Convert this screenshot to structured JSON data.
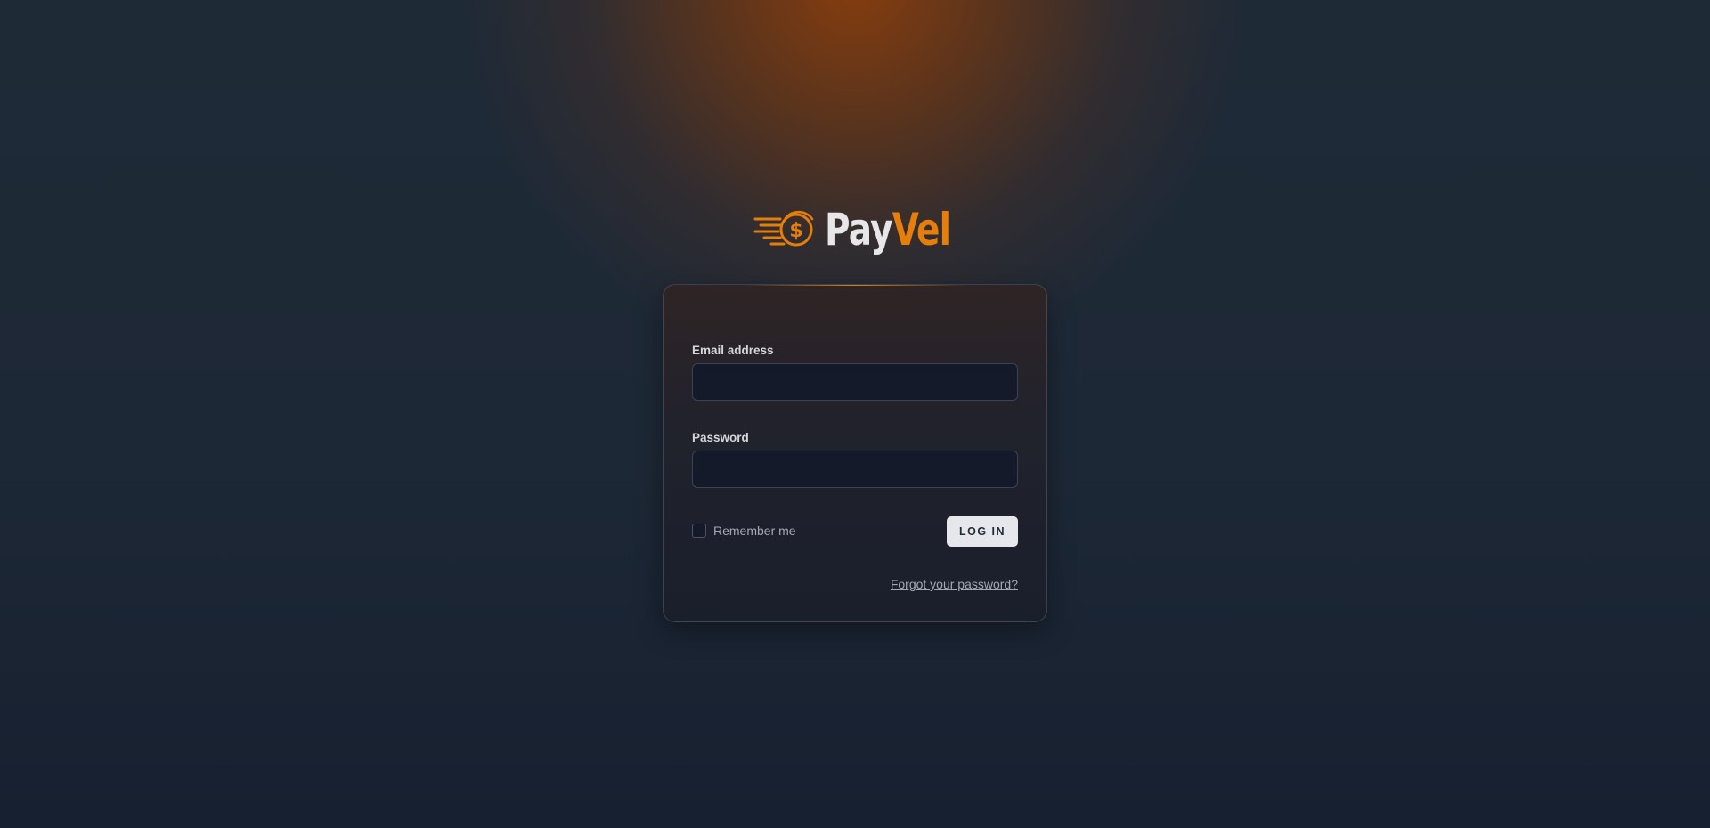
{
  "brand": {
    "name_part1": "Pay",
    "name_part2": "Vel",
    "logo_icon": "flying-dollar-coin-icon",
    "accent_color": "#e67e0c"
  },
  "form": {
    "email_label": "Email address",
    "email_value": "",
    "password_label": "Password",
    "password_value": "",
    "remember_label": "Remember me",
    "remember_checked": false,
    "login_button": "LOG IN",
    "forgot_link": "Forgot your password?"
  },
  "colors": {
    "background": "#1f2a37",
    "glow": "#8c3e0c",
    "card": "#1a1f2b",
    "input_bg": "#141a29",
    "button_bg": "#e5e7eb"
  }
}
